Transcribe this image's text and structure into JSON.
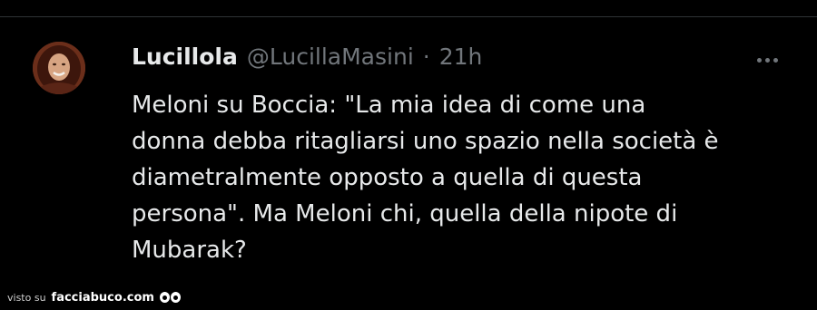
{
  "tweet": {
    "display_name": "Lucillola",
    "handle": "@LucillaMasini",
    "separator": "·",
    "time": "21h",
    "text_lines": [
      "Meloni su Boccia: \"La mia idea di come una",
      "donna debba ritagliarsi uno spazio nella società è",
      "diametralmente opposto a quella di questa",
      "persona\". Ma Meloni chi, quella della nipote di",
      "Mubarak?"
    ],
    "more_icon": "more-horizontal-icon",
    "avatar_icon": "avatar-photo"
  },
  "watermark": {
    "prefix": "visto su",
    "site": "facciabuco.com",
    "icon": "eyes-icon"
  },
  "colors": {
    "background": "#000000",
    "primary_text": "#e7e9ea",
    "secondary_text": "#71767b",
    "divider": "#2f3336"
  }
}
